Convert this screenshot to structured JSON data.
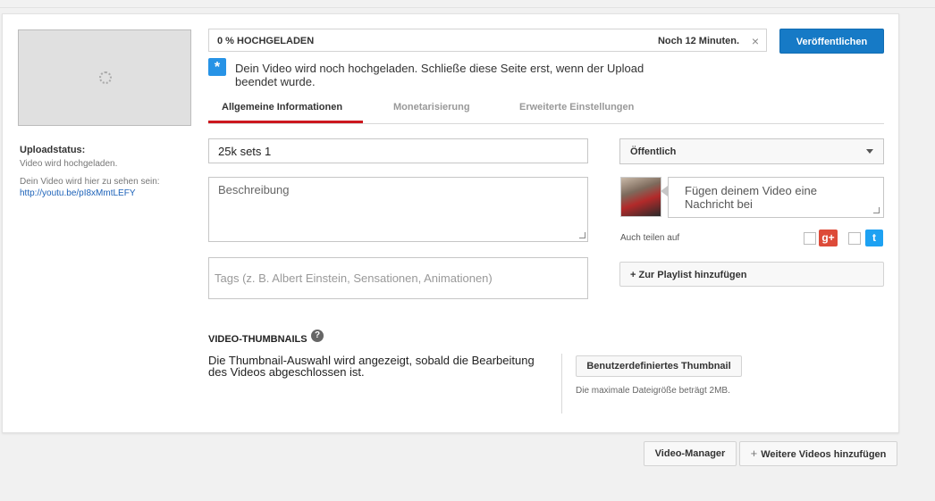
{
  "upload": {
    "progress_label": "0 % HOCHGELADEN",
    "progress_fraction": 0,
    "time_remaining": "Noch 12 Minuten.",
    "cancel_icon": "×",
    "publish_label": "Veröffentlichen",
    "notice": "Dein Video wird noch hochgeladen. Schließe diese Seite erst, wenn der Upload beendet wurde."
  },
  "sidebar": {
    "status_title": "Uploadstatus:",
    "status_value": "Video wird hochgeladen.",
    "link_caption": "Dein Video wird hier zu sehen sein:",
    "link_url": "http://youtu.be/pI8xMmtLEFY"
  },
  "tabs": [
    {
      "label": "Allgemeine Informationen",
      "active": true
    },
    {
      "label": "Monetarisierung",
      "active": false
    },
    {
      "label": "Erweiterte Einstellungen",
      "active": false
    }
  ],
  "form": {
    "title_value": "25k sets 1",
    "description_placeholder": "Beschreibung",
    "tags_placeholder": "Tags (z. B. Albert Einstein, Sensationen, Animationen)"
  },
  "privacy": {
    "selected": "Öffentlich"
  },
  "share": {
    "message_placeholder": "Fügen deinem Video eine Nachricht bei",
    "label": "Auch teilen auf",
    "gplus_icon": "g+",
    "twitter_icon": "t"
  },
  "playlist": {
    "add_label": "+ Zur Playlist hinzufügen"
  },
  "thumbnails": {
    "heading": "VIDEO-THUMBNAILS",
    "help_icon": "?",
    "text": "Die Thumbnail-Auswahl wird angezeigt, sobald die Bearbeitung des Videos abgeschlossen ist.",
    "custom_button": "Benutzerdefiniertes Thumbnail",
    "max_size_note": "Die maximale Dateigröße beträgt 2MB."
  },
  "footer": {
    "video_manager": "Video-Manager",
    "add_more_plus": "+",
    "add_more": "Weitere Videos hinzufügen"
  },
  "colors": {
    "accent": "#167ac6",
    "tab_active": "#cc181e",
    "link": "#1c62b9"
  }
}
